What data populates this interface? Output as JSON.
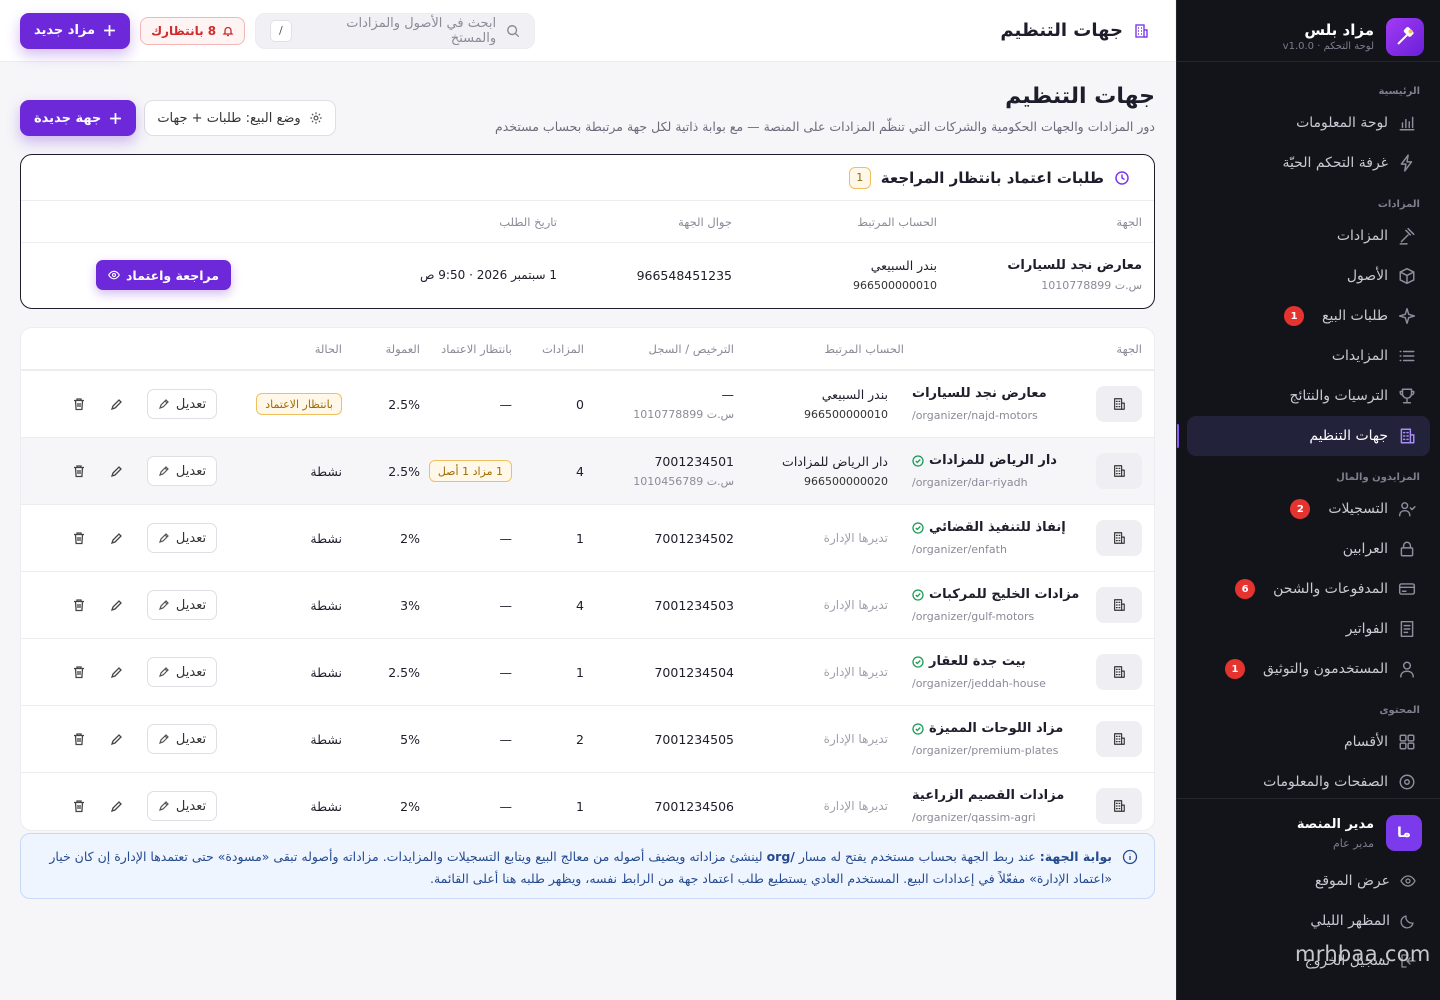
{
  "brand": {
    "name": "مزاد بلس",
    "sub": "لوحة التحكم · v1.0.0"
  },
  "sidebar": {
    "sections": [
      {
        "title": "الرئيسية",
        "items": [
          {
            "label": "لوحة المعلومات",
            "icon": "chart-bars-icon"
          },
          {
            "label": "غرفة التحكم الحيّة",
            "icon": "lightning-icon"
          }
        ]
      },
      {
        "title": "المزادات",
        "items": [
          {
            "label": "المزادات",
            "icon": "gavel-icon"
          },
          {
            "label": "الأصول",
            "icon": "box-icon"
          },
          {
            "label": "طلبات البيع",
            "icon": "sparkle-icon",
            "badge": "1"
          },
          {
            "label": "المزايدات",
            "icon": "list-icon"
          },
          {
            "label": "الترسيات والنتائج",
            "icon": "trophy-icon"
          },
          {
            "label": "جهات التنظيم",
            "icon": "building-icon",
            "active": true
          }
        ]
      },
      {
        "title": "المزايدون والمال",
        "items": [
          {
            "label": "التسجيلات",
            "icon": "user-check-icon",
            "badge": "2"
          },
          {
            "label": "العرابين",
            "icon": "lock-icon"
          },
          {
            "label": "المدفوعات والشحن",
            "icon": "credit-card-icon",
            "badge": "6"
          },
          {
            "label": "الفواتير",
            "icon": "invoice-icon"
          },
          {
            "label": "المستخدمون والتوثيق",
            "icon": "user-icon",
            "badge": "1"
          }
        ]
      },
      {
        "title": "المحتوى",
        "items": [
          {
            "label": "الأقسام",
            "icon": "grid-icon"
          },
          {
            "label": "الصفحات والمعلومات",
            "icon": "settings-circle-icon"
          }
        ]
      }
    ],
    "user": {
      "initials": "ما",
      "name": "مدير المنصة",
      "role": "مدير عام"
    },
    "footer": [
      {
        "label": "عرض الموقع",
        "icon": "eye-icon"
      },
      {
        "label": "المظهر الليلي",
        "icon": "moon-icon"
      },
      {
        "label": "تسجيل الخروج",
        "icon": "logout-icon"
      }
    ],
    "watermark": "mrhbaa.com"
  },
  "topbar": {
    "title": "جهات التنظيم",
    "search_placeholder": "ابحث في الأصول والمزادات والمستخ",
    "search_kbd": "/",
    "pending_label": "8 بانتظارك",
    "new_auction_label": "مزاد جديد"
  },
  "page": {
    "title": "جهات التنظيم",
    "description": "دور المزادات والجهات الحكومية والشركات التي تنظّم المزادات على المنصة — مع بوابة ذاتية لكل جهة مرتبطة بحساب مستخدم",
    "sell_mode_label": "وضع البيع: طلبات + جهات",
    "new_org_label": "جهة جديدة"
  },
  "pending": {
    "title": "طلبات اعتماد بانتظار المراجعة",
    "count": "1",
    "columns": [
      "الجهة",
      "الحساب المرتبط",
      "جوال الجهة",
      "تاريخ الطلب"
    ],
    "rows": [
      {
        "name": "معارض نجد للسيارات",
        "cr": "س.ت 1010778899",
        "account": "بندر السبيعي",
        "account_phone": "966500000010",
        "phone": "966548451235",
        "date": "1 سبتمبر 2026 · 9:50 ص",
        "action": "مراجعة واعتماد"
      }
    ]
  },
  "organizers": {
    "columns": [
      "الجهة",
      "الحساب المرتبط",
      "الترخيص / السجل",
      "المزادات",
      "بانتظار الاعتماد",
      "العمولة",
      "الحالة"
    ],
    "edit_label": "تعديل",
    "rows": [
      {
        "name": "معارض نجد للسيارات",
        "verified": false,
        "slug": "/organizer/najd-motors",
        "account": "بندر السبيعي",
        "account_phone": "966500000010",
        "license": "—",
        "cr": "س.ت 1010778899",
        "auctions": "0",
        "pending": "—",
        "commission": "2.5%",
        "status": "بانتظار الاعتماد",
        "status_type": "pending"
      },
      {
        "name": "دار الرياض للمزادات",
        "verified": true,
        "slug": "/organizer/dar-riyadh",
        "account": "دار الرياض للمزادات",
        "account_phone": "966500000020",
        "license": "7001234501",
        "cr": "س.ت 1010456789",
        "auctions": "4",
        "pending": "1 مزاد 1 أصل",
        "commission": "2.5%",
        "status": "نشطة",
        "status_type": "active",
        "highlight": true
      },
      {
        "name": "إنفاذ للتنفيذ القضائي",
        "verified": true,
        "slug": "/organizer/enfath",
        "account": "تديرها الإدارة",
        "account_phone": "",
        "license": "7001234502",
        "cr": "",
        "auctions": "1",
        "pending": "—",
        "commission": "2%",
        "status": "نشطة",
        "status_type": "active"
      },
      {
        "name": "مزادات الخليج للمركبات",
        "verified": true,
        "slug": "/organizer/gulf-motors",
        "account": "تديرها الإدارة",
        "account_phone": "",
        "license": "7001234503",
        "cr": "",
        "auctions": "4",
        "pending": "—",
        "commission": "3%",
        "status": "نشطة",
        "status_type": "active"
      },
      {
        "name": "بيت جدة للعقار",
        "verified": true,
        "slug": "/organizer/jeddah-house",
        "account": "تديرها الإدارة",
        "account_phone": "",
        "license": "7001234504",
        "cr": "",
        "auctions": "1",
        "pending": "—",
        "commission": "2.5%",
        "status": "نشطة",
        "status_type": "active"
      },
      {
        "name": "مزاد اللوحات المميزة",
        "verified": true,
        "slug": "/organizer/premium-plates",
        "account": "تديرها الإدارة",
        "account_phone": "",
        "license": "7001234505",
        "cr": "",
        "auctions": "2",
        "pending": "—",
        "commission": "5%",
        "status": "نشطة",
        "status_type": "active"
      },
      {
        "name": "مزادات القصيم الزراعية",
        "verified": false,
        "slug": "/organizer/qassim-agri",
        "account": "تديرها الإدارة",
        "account_phone": "",
        "license": "7001234506",
        "cr": "",
        "auctions": "1",
        "pending": "—",
        "commission": "2%",
        "status": "نشطة",
        "status_type": "active"
      }
    ]
  },
  "info": {
    "bold": "بوابة الجهة:",
    "text1": "عند ربط الجهة بحساب مستخدم يفتح له مسار",
    "path": "/org",
    "text2": "لينشئ مزاداته ويضيف أصوله من معالج البيع ويتابع التسجيلات والمزايدات. مزاداته وأصوله تبقى «مسودة» حتى تعتمدها الإدارة إن كان خيار",
    "line2": "«اعتماد الإدارة» مفعّلاً في إعدادات البيع. المستخدم العادي يستطيع طلب اعتماد جهة من الرابط نفسه، ويظهر طلبه هنا أعلى القائمة."
  },
  "colors": {
    "accent": "#6d28d9",
    "sidebar_bg": "#13131a",
    "danger": "#e5342f",
    "success": "#1a9c55",
    "amber": "#f0c060"
  }
}
